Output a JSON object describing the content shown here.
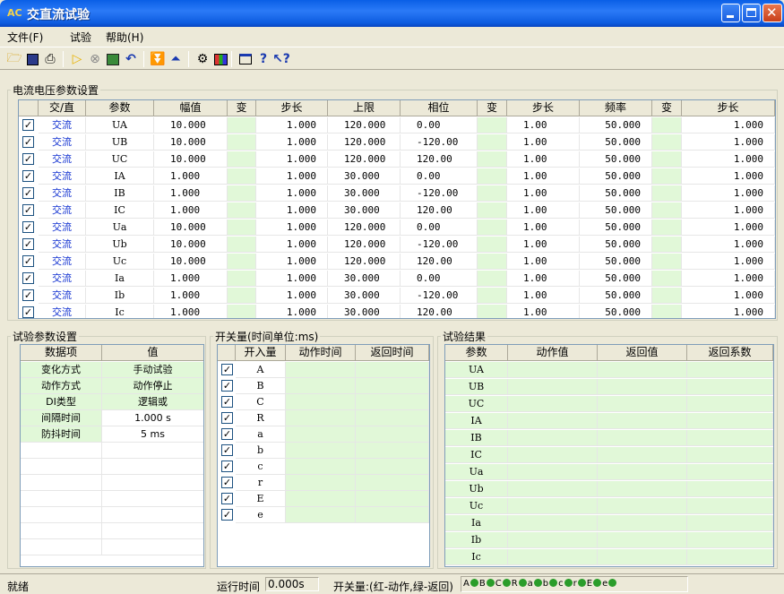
{
  "window": {
    "title": "交直流试验",
    "icon_label": "AC"
  },
  "menu": [
    "文件(F)",
    "试验",
    "帮助(H)"
  ],
  "toolbar_icons": [
    "open-icon",
    "save-icon",
    "print-icon",
    "run-icon",
    "stop-icon",
    "chart-icon",
    "undo-icon",
    "down-icon",
    "up-icon",
    "settings-icon",
    "bar-chart-icon",
    "window-icon",
    "help-icon",
    "context-help-icon"
  ],
  "params": {
    "title": "电流电压参数设置",
    "headers": [
      "交/直",
      "参数",
      "幅值",
      "变",
      "步长",
      "上限",
      "相位",
      "变",
      "步长",
      "频率",
      "变",
      "步长"
    ],
    "rows": [
      [
        "交流",
        "UA",
        "10.000",
        "",
        "1.000",
        "120.000",
        "0.00",
        "",
        "1.00",
        "50.000",
        "",
        "1.000"
      ],
      [
        "交流",
        "UB",
        "10.000",
        "",
        "1.000",
        "120.000",
        "-120.00",
        "",
        "1.00",
        "50.000",
        "",
        "1.000"
      ],
      [
        "交流",
        "UC",
        "10.000",
        "",
        "1.000",
        "120.000",
        "120.00",
        "",
        "1.00",
        "50.000",
        "",
        "1.000"
      ],
      [
        "交流",
        "IA",
        "1.000",
        "",
        "1.000",
        "30.000",
        "0.00",
        "",
        "1.00",
        "50.000",
        "",
        "1.000"
      ],
      [
        "交流",
        "IB",
        "1.000",
        "",
        "1.000",
        "30.000",
        "-120.00",
        "",
        "1.00",
        "50.000",
        "",
        "1.000"
      ],
      [
        "交流",
        "IC",
        "1.000",
        "",
        "1.000",
        "30.000",
        "120.00",
        "",
        "1.00",
        "50.000",
        "",
        "1.000"
      ],
      [
        "交流",
        "Ua",
        "10.000",
        "",
        "1.000",
        "120.000",
        "0.00",
        "",
        "1.00",
        "50.000",
        "",
        "1.000"
      ],
      [
        "交流",
        "Ub",
        "10.000",
        "",
        "1.000",
        "120.000",
        "-120.00",
        "",
        "1.00",
        "50.000",
        "",
        "1.000"
      ],
      [
        "交流",
        "Uc",
        "10.000",
        "",
        "1.000",
        "120.000",
        "120.00",
        "",
        "1.00",
        "50.000",
        "",
        "1.000"
      ],
      [
        "交流",
        "Ia",
        "1.000",
        "",
        "1.000",
        "30.000",
        "0.00",
        "",
        "1.00",
        "50.000",
        "",
        "1.000"
      ],
      [
        "交流",
        "Ib",
        "1.000",
        "",
        "1.000",
        "30.000",
        "-120.00",
        "",
        "1.00",
        "50.000",
        "",
        "1.000"
      ],
      [
        "交流",
        "Ic",
        "1.000",
        "",
        "1.000",
        "30.000",
        "120.00",
        "",
        "1.00",
        "50.000",
        "",
        "1.000"
      ]
    ]
  },
  "test_settings": {
    "title": "试验参数设置",
    "headers": [
      "数据项",
      "值"
    ],
    "rows": [
      [
        "变化方式",
        "手动试验"
      ],
      [
        "动作方式",
        "动作停止"
      ],
      [
        "DI类型",
        "逻辑或"
      ],
      [
        "间隔时间",
        "1.000 s"
      ],
      [
        "防抖时间",
        "5 ms"
      ]
    ]
  },
  "switches": {
    "title": "开关量(时间单位:ms)",
    "headers": [
      "开入量",
      "动作时间",
      "返回时间"
    ],
    "rows": [
      "A",
      "B",
      "C",
      "R",
      "a",
      "b",
      "c",
      "r",
      "E",
      "e"
    ]
  },
  "results": {
    "title": "试验结果",
    "headers": [
      "参数",
      "动作值",
      "返回值",
      "返回系数"
    ],
    "rows": [
      "UA",
      "UB",
      "UC",
      "IA",
      "IB",
      "IC",
      "Ua",
      "Ub",
      "Uc",
      "Ia",
      "Ib",
      "Ic"
    ]
  },
  "status": {
    "ready": "就绪",
    "runtime_label": "运行时间",
    "runtime_value": "0.000s",
    "switch_legend": "开关量:(红-动作,绿-返回)",
    "indicators": [
      "A",
      "B",
      "C",
      "R",
      "a",
      "b",
      "c",
      "r",
      "E",
      "e"
    ]
  },
  "colors": {
    "title_bar": "#0A5FE6",
    "green_cell": "#E1F8D8",
    "ac_text": "#1030D0",
    "indicator": "#2A9D2A"
  }
}
